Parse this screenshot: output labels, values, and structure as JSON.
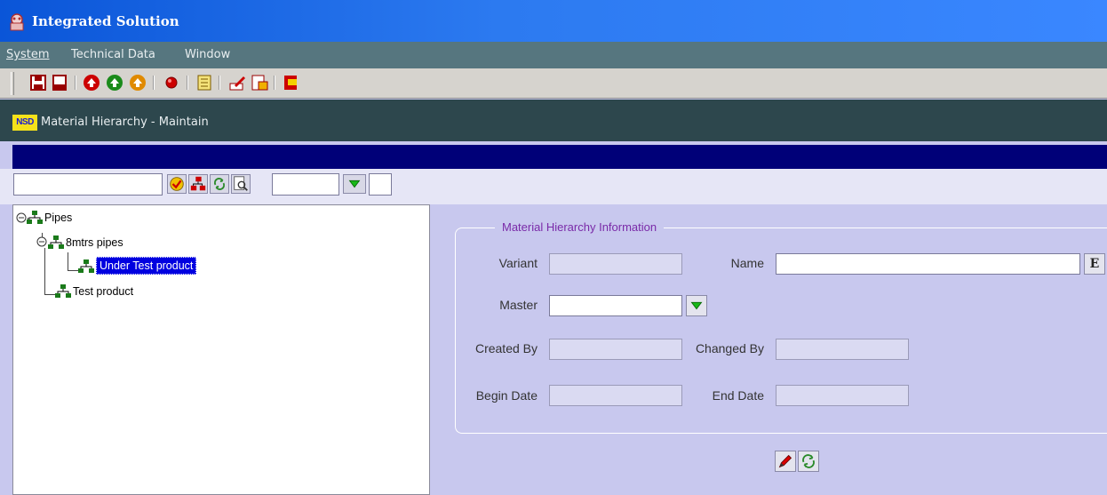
{
  "window": {
    "title": "Integrated Solution"
  },
  "menu": {
    "system": "System",
    "technical_data": "Technical Data",
    "window": "Window"
  },
  "toolbar": {
    "icons": [
      "save-icon",
      "print-icon",
      "first-record-icon",
      "previous-record-icon",
      "next-record-icon",
      "record-icon",
      "list-icon",
      "edit-icon",
      "export-icon",
      "exit-icon"
    ]
  },
  "form": {
    "logo": "NSD",
    "title": "Material  Hierarchy - Maintain"
  },
  "search": {
    "query": "",
    "combo_value": "",
    "extra_value": ""
  },
  "tree": {
    "root": "Pipes",
    "child": "8mtrs pipes",
    "selected_leaf": "Under Test product",
    "sibling": "Test product"
  },
  "details": {
    "legend": "Material Hierarchy Information",
    "variant_label": "Variant",
    "variant_value": "",
    "name_label": "Name",
    "name_value": "",
    "edit_button_text": "E",
    "master_label": "Master",
    "master_value": "",
    "created_by_label": "Created By",
    "created_by_value": "",
    "changed_by_label": "Changed By",
    "changed_by_value": "",
    "begin_date_label": "Begin Date",
    "begin_date_value": "",
    "end_date_label": "End Date",
    "end_date_value": ""
  },
  "colors": {
    "titlebar": "#2c7af0",
    "menubar": "#56767f",
    "form_header": "#2d474d",
    "navy_bar": "#000078",
    "panel_bg": "#c8c8ee",
    "selection": "#0000e0",
    "legend_text": "#7a2aa8"
  }
}
